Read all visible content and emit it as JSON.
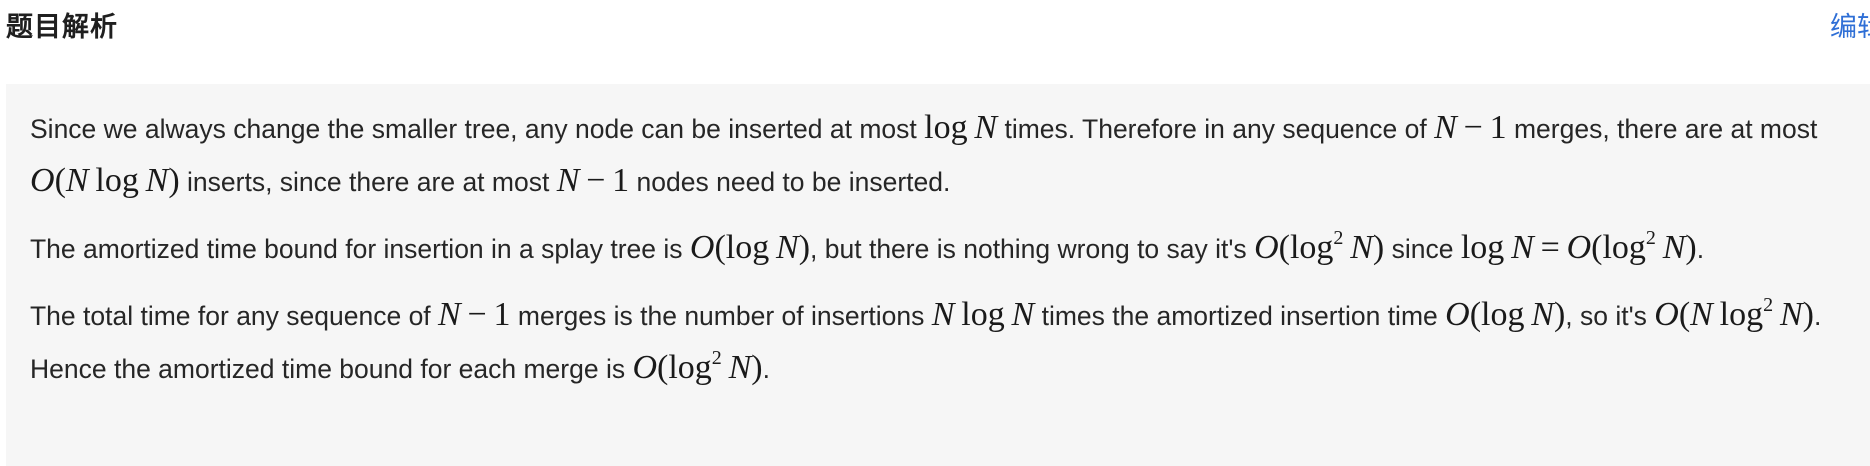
{
  "header": {
    "title": "题目解析",
    "edit_label": "编辑"
  },
  "solution": {
    "p1": {
      "t1": "Since we always change the smaller tree, any node can be inserted at most ",
      "t2": " times.  Therefore  in any sequence of ",
      "t3": " merges, there are at most ",
      "t4": " inserts, since there are at most ",
      "t5": " nodes need to be inserted."
    },
    "p2": {
      "t1": "The amortized time bound for insertion in a splay tree is ",
      "t2": ", but there is nothing wrong to say it's ",
      "t3": " since ",
      "t4": "."
    },
    "p3": {
      "t1": "The total time for any sequence of ",
      "t2": " merges is the number of insertions ",
      "t3": " times the amortized insertion time ",
      "t4": ", so it's ",
      "t5": ".  Hence the amortized time bound for each merge is ",
      "t6": "."
    }
  }
}
